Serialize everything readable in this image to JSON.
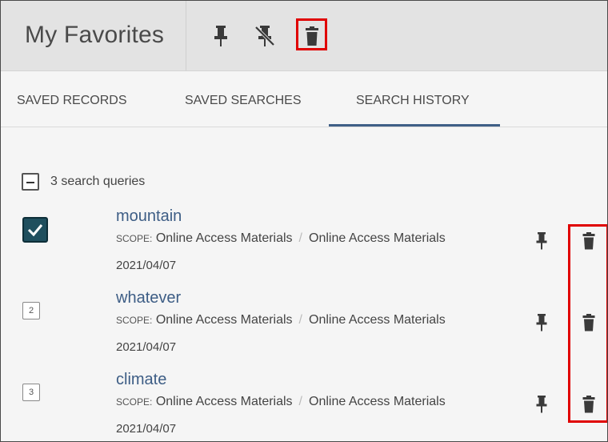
{
  "header": {
    "title": "My Favorites",
    "icons": [
      "pin-icon",
      "unpin-icon",
      "trash-icon"
    ]
  },
  "tabs": [
    {
      "label": "SAVED RECORDS",
      "active": false
    },
    {
      "label": "SAVED SEARCHES",
      "active": false
    },
    {
      "label": "SEARCH HISTORY",
      "active": true
    }
  ],
  "list": {
    "count_text": "3 search queries",
    "scope_label": "SCOPE:",
    "items": [
      {
        "marker": "",
        "checked": true,
        "query": "mountain",
        "scope_a": "Online Access Materials",
        "scope_b": "Online Access Materials",
        "date": "2021/04/07"
      },
      {
        "marker": "2",
        "checked": false,
        "query": "whatever",
        "scope_a": "Online Access Materials",
        "scope_b": "Online Access Materials",
        "date": "2021/04/07"
      },
      {
        "marker": "3",
        "checked": false,
        "query": "climate",
        "scope_a": "Online Access Materials",
        "scope_b": "Online Access Materials",
        "date": "2021/04/07"
      }
    ]
  },
  "colors": {
    "accent": "#3d5d85",
    "checkbox_checked": "#1f4f5e",
    "highlight": "#e00000",
    "icon": "#3a3a3a"
  }
}
